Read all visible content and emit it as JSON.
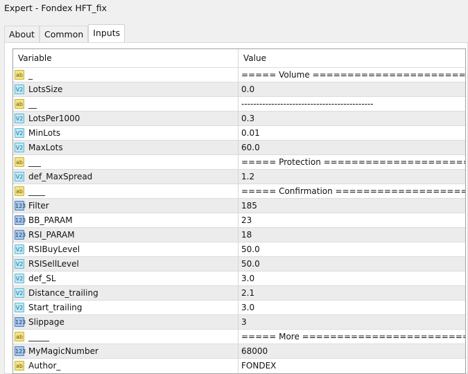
{
  "window": {
    "title": "Expert - Fondex HFT_fix"
  },
  "tabs": [
    {
      "label": "About"
    },
    {
      "label": "Common"
    },
    {
      "label": "Inputs",
      "active": true
    }
  ],
  "grid": {
    "headers": {
      "variable": "Variable",
      "value": "Value"
    },
    "rows": [
      {
        "type": "string",
        "icon": "ab-string-icon",
        "name": "_",
        "value": "===== Volume =======================..."
      },
      {
        "type": "double",
        "icon": "double-icon",
        "name": "LotsSize",
        "value": "0.0"
      },
      {
        "type": "string",
        "icon": "ab-string-icon",
        "name": "__",
        "value": "--------------------------------------------"
      },
      {
        "type": "double",
        "icon": "double-icon",
        "name": "LotsPer1000",
        "value": "0.3"
      },
      {
        "type": "double",
        "icon": "double-icon",
        "name": "MinLots",
        "value": "0.01"
      },
      {
        "type": "double",
        "icon": "double-icon",
        "name": "MaxLots",
        "value": "60.0"
      },
      {
        "type": "string",
        "icon": "ab-string-icon",
        "name": "___",
        "value": "===== Protection ======================..."
      },
      {
        "type": "double",
        "icon": "double-icon",
        "name": "def_MaxSpread",
        "value": "1.2"
      },
      {
        "type": "string",
        "icon": "ab-string-icon",
        "name": "____",
        "value": "===== Confirmation ====================..."
      },
      {
        "type": "int",
        "icon": "integer-icon",
        "name": "Filter",
        "value": "185"
      },
      {
        "type": "int",
        "icon": "integer-icon",
        "name": "BB_PARAM",
        "value": "23"
      },
      {
        "type": "int",
        "icon": "integer-icon",
        "name": "RSI_PARAM",
        "value": "18"
      },
      {
        "type": "double",
        "icon": "double-icon",
        "name": "RSIBuyLevel",
        "value": "50.0"
      },
      {
        "type": "double",
        "icon": "double-icon",
        "name": "RSISellLevel",
        "value": "50.0"
      },
      {
        "type": "double",
        "icon": "double-icon",
        "name": "def_SL",
        "value": "3.0"
      },
      {
        "type": "double",
        "icon": "double-icon",
        "name": "Distance_trailing",
        "value": "2.1"
      },
      {
        "type": "double",
        "icon": "double-icon",
        "name": "Start_trailing",
        "value": "3.0"
      },
      {
        "type": "int",
        "icon": "integer-icon",
        "name": "Slippage",
        "value": "3"
      },
      {
        "type": "string",
        "icon": "ab-string-icon",
        "name": "_____",
        "value": "===== More ==========================..."
      },
      {
        "type": "int",
        "icon": "integer-icon",
        "name": "MyMagicNumber",
        "value": "68000"
      },
      {
        "type": "string",
        "icon": "ab-string-icon",
        "name": "Author_",
        "value": "FONDEX"
      }
    ]
  },
  "icon_glyphs": {
    "string": "ab",
    "double": "V2",
    "int": "123"
  }
}
